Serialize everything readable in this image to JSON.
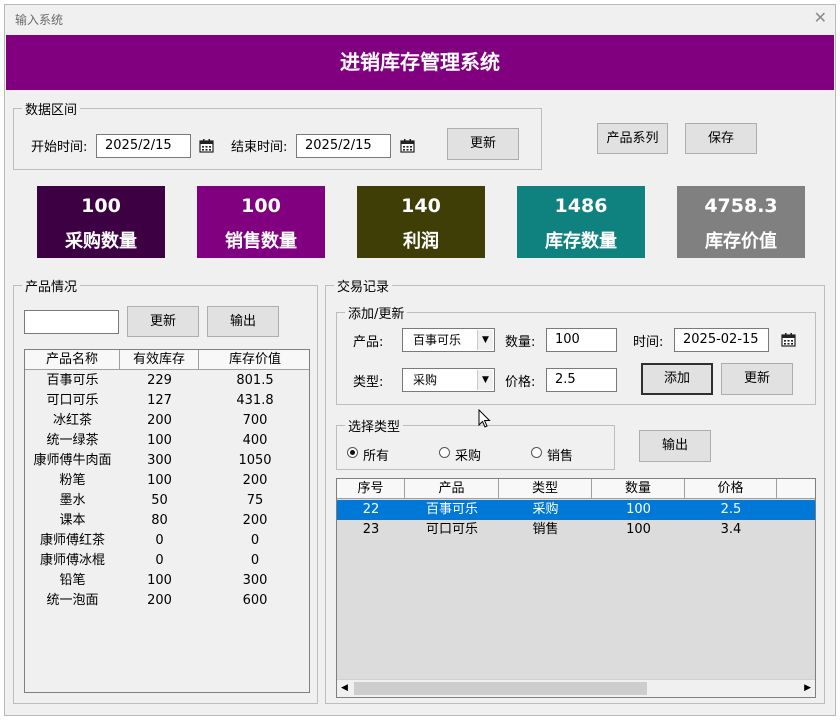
{
  "window": {
    "title": "输入系统",
    "close_glyph": "✕"
  },
  "banner": {
    "title": "进销库存管理系统"
  },
  "date_range": {
    "legend": "数据区间",
    "start_label": "开始时间:",
    "start_value": "2025/2/15",
    "end_label": "结束时间:",
    "end_value": "2025/2/15",
    "update_button": "更新"
  },
  "top_buttons": {
    "product_series": "产品系列",
    "save": "保存"
  },
  "cards": [
    {
      "value": "100",
      "label": "采购数量",
      "color": "#3d0043"
    },
    {
      "value": "100",
      "label": "销售数量",
      "color": "#800080"
    },
    {
      "value": "140",
      "label": "利润",
      "color": "#3e3e06"
    },
    {
      "value": "1486",
      "label": "库存数量",
      "color": "#0f817f"
    },
    {
      "value": "4758.3",
      "label": "库存价值",
      "color": "#808080"
    }
  ],
  "product_panel": {
    "legend": "产品情况",
    "search_value": "",
    "update_button": "更新",
    "export_button": "输出",
    "columns": [
      "产品名称",
      "有效库存",
      "库存价值"
    ],
    "rows": [
      [
        "百事可乐",
        "229",
        "801.5"
      ],
      [
        "可口可乐",
        "127",
        "431.8"
      ],
      [
        "冰红茶",
        "200",
        "700"
      ],
      [
        "统一绿茶",
        "100",
        "400"
      ],
      [
        "康师傅牛肉面",
        "300",
        "1050"
      ],
      [
        "粉笔",
        "100",
        "200"
      ],
      [
        "墨水",
        "50",
        "75"
      ],
      [
        "课本",
        "80",
        "200"
      ],
      [
        "康师傅红茶",
        "0",
        "0"
      ],
      [
        "康师傅冰棍",
        "0",
        "0"
      ],
      [
        "铅笔",
        "100",
        "300"
      ],
      [
        "统一泡面",
        "200",
        "600"
      ]
    ]
  },
  "transactions": {
    "legend": "交易记录",
    "add_update": {
      "legend": "添加/更新",
      "product_label": "产品:",
      "product_value": "百事可乐",
      "qty_label": "数量:",
      "qty_value": "100",
      "time_label": "时间:",
      "time_value": "2025-02-15",
      "type_label": "类型:",
      "type_value": "采购",
      "price_label": "价格:",
      "price_value": "2.5",
      "add_button": "添加",
      "update_button": "更新"
    },
    "filter": {
      "legend": "选择类型",
      "options": [
        "所有",
        "采购",
        "销售"
      ],
      "selected": "所有",
      "export_button": "输出"
    },
    "columns": [
      "序号",
      "产品",
      "类型",
      "数量",
      "价格"
    ],
    "rows": [
      [
        "22",
        "百事可乐",
        "采购",
        "100",
        "2.5"
      ],
      [
        "23",
        "可口可乐",
        "销售",
        "100",
        "3.4"
      ]
    ],
    "selected_row": 0
  }
}
